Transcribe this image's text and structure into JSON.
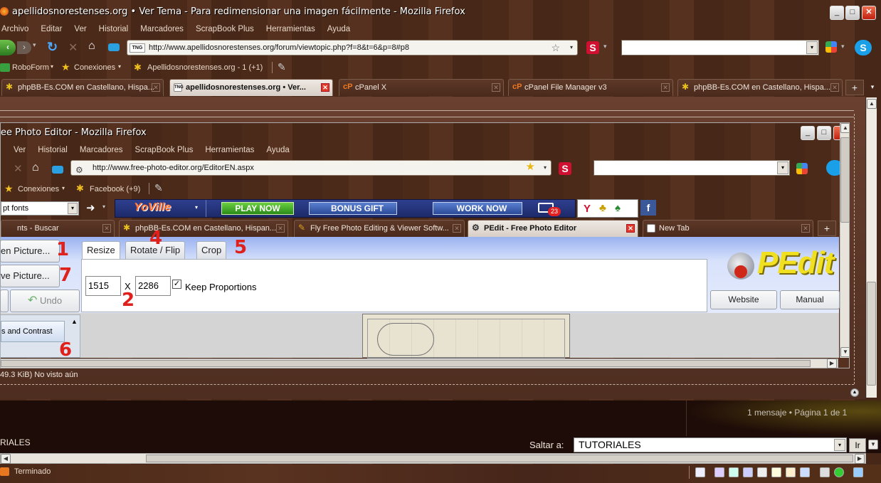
{
  "outer": {
    "title": "apellidosnorestenses.org • Ver Tema - Para redimensionar una imagen fácilmente - Mozilla Firefox",
    "menu": [
      "Archivo",
      "Editar",
      "Ver",
      "Historial",
      "Marcadores",
      "ScrapBook Plus",
      "Herramientas",
      "Ayuda"
    ],
    "url": "http://www.apellidosnorestenses.org/forum/viewtopic.php?f=8&t=6&p=8#p8",
    "url_badge": "TNG",
    "bookmarks": [
      "RoboForm",
      "Conexiones",
      "Apellidosnorestenses.org - 1 (+1)"
    ],
    "tabs": [
      {
        "label": "phpBB-Es.COM en Castellano, Hispa...",
        "active": false
      },
      {
        "label": "apellidosnorestenses.org • Ver...",
        "active": true
      },
      {
        "label": "cPanel X",
        "active": false
      },
      {
        "label": "cPanel File Manager v3",
        "active": false
      },
      {
        "label": "phpBB-Es.COM en Castellano, Hispa...",
        "active": false
      }
    ],
    "attach_info": "49.3 KiB) No visto aún",
    "posts_info": "1 mensaje • Página 1 de 1",
    "forum_label": "RIALES",
    "jump_label": "Saltar a:",
    "jump_value": "TUTORIALES",
    "go_button": "Ir",
    "status": "Terminado"
  },
  "inner": {
    "title": "ee Photo Editor - Mozilla Firefox",
    "menu": [
      "Ver",
      "Historial",
      "Marcadores",
      "ScrapBook Plus",
      "Herramientas",
      "Ayuda"
    ],
    "url": "http://www.free-photo-editor.org/EditorEN.aspx",
    "bookmarks": [
      "Conexiones",
      "Facebook (+9)"
    ],
    "font_select": "pt fonts",
    "game_bar": {
      "logo": "YoVille",
      "play": "PLAY NOW",
      "bonus": "BONUS GIFT",
      "work": "WORK NOW",
      "mail_count": "23"
    },
    "tabs": [
      {
        "label": "nts - Buscar",
        "active": false
      },
      {
        "label": "phpBB-Es.COM en Castellano, Hispan...",
        "active": false
      },
      {
        "label": "Fly Free Photo Editing & Viewer Softw...",
        "active": false
      },
      {
        "label": "PEdit - Free Photo Editor",
        "active": true
      },
      {
        "label": "New Tab",
        "active": false
      }
    ]
  },
  "pedit": {
    "open_button": "en Picture...",
    "save_button": "ve Picture...",
    "undo_button": "Undo",
    "tabs": [
      "Resize",
      "Rotate / Flip",
      "Crop"
    ],
    "width": "1515",
    "height": "2286",
    "times": "X",
    "keep_label": "Keep Proportions",
    "keep_checked": true,
    "list_item": "s and Contrast",
    "logo": "PEdit",
    "website_button": "Website",
    "manual_button": "Manual",
    "markers": [
      "1",
      "7",
      "4",
      "5",
      "2",
      "6"
    ]
  }
}
